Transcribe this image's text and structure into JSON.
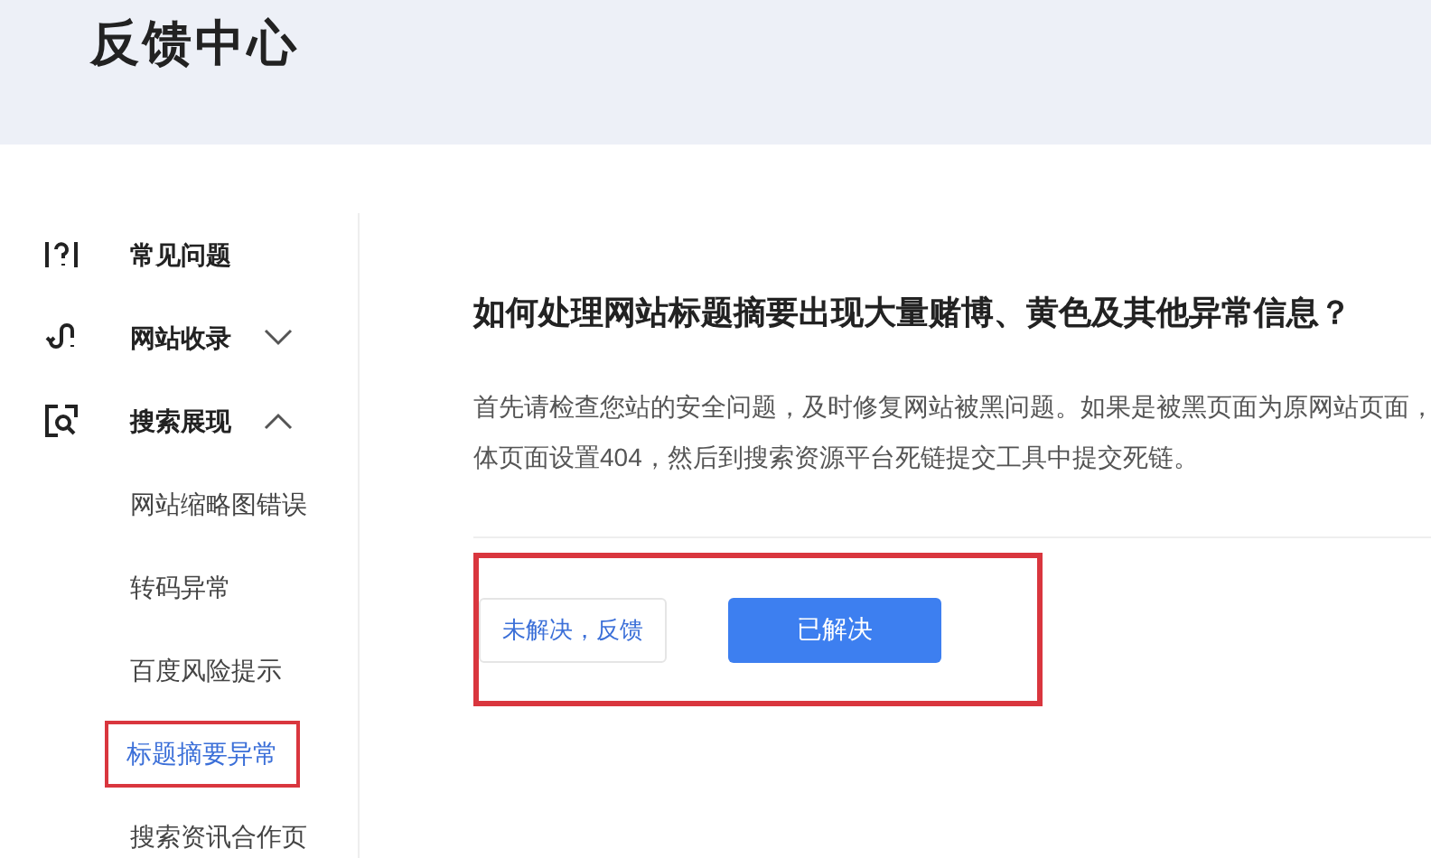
{
  "header": {
    "title": "反馈中心"
  },
  "sidebar": {
    "items": [
      {
        "label": "常见问题",
        "kind": "question"
      },
      {
        "label": "网站收录",
        "kind": "link",
        "expanded": false
      },
      {
        "label": "搜索展现",
        "kind": "search",
        "expanded": true,
        "children": [
          {
            "label": "网站缩略图错误",
            "selected": false,
            "highlighted": false
          },
          {
            "label": "转码异常",
            "selected": false,
            "highlighted": false
          },
          {
            "label": "百度风险提示",
            "selected": false,
            "highlighted": false
          },
          {
            "label": "标题摘要异常",
            "selected": true,
            "highlighted": true
          },
          {
            "label": "搜索资讯合作页",
            "selected": false,
            "highlighted": false
          }
        ]
      }
    ]
  },
  "article": {
    "title": "如何处理网站标题摘要出现大量赌博、黄色及其他异常信息？",
    "body_lines": [
      "首先请检查您站的安全问题，及时修复网站被黑问题。如果是被黑页面为原网站页面，",
      "体页面设置404，然后到搜索资源平台死链提交工具中提交死链。"
    ]
  },
  "actions": {
    "highlighted": true,
    "buttons": [
      {
        "label": "未解决，反馈",
        "kind": "outline"
      },
      {
        "label": "已解决",
        "kind": "primary"
      }
    ]
  }
}
